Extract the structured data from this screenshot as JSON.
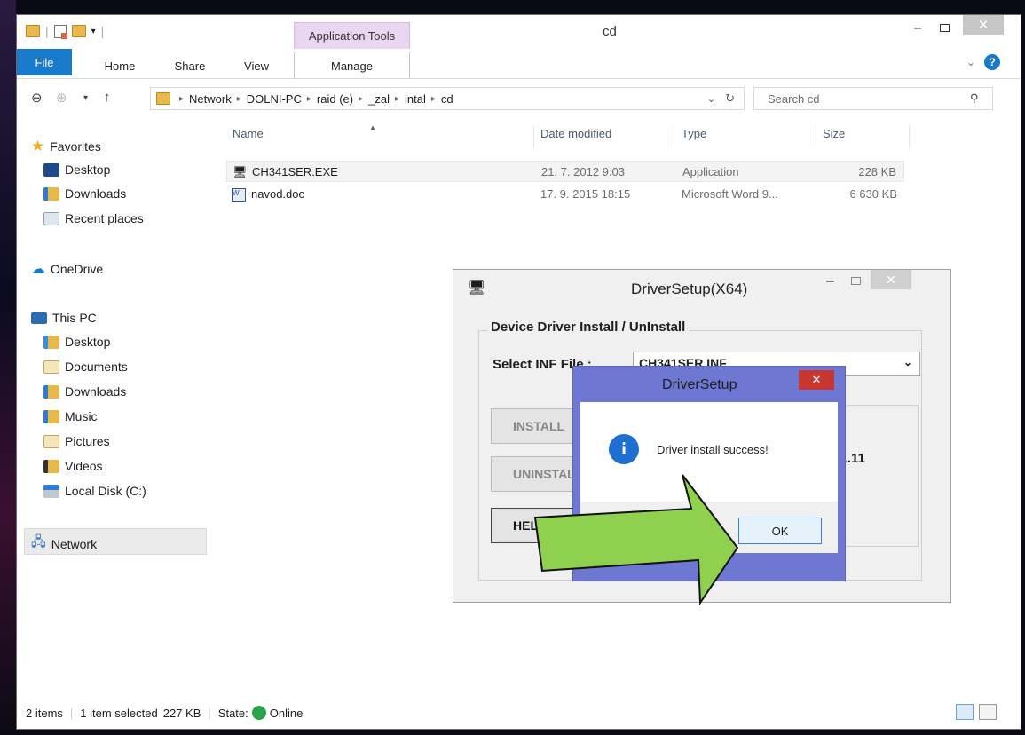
{
  "window": {
    "title": "cd",
    "app_tools_label": "Application Tools"
  },
  "ribbon": {
    "tabs": [
      "File",
      "Home",
      "Share",
      "View",
      "Manage"
    ]
  },
  "address": {
    "path": [
      "Network",
      "DOLNI-PC",
      "raid (e)",
      "_zal",
      "intal",
      "cd"
    ],
    "search_placeholder": "Search cd"
  },
  "nav": {
    "favorites": "Favorites",
    "favorites_items": [
      "Desktop",
      "Downloads",
      "Recent places"
    ],
    "onedrive": "OneDrive",
    "thispc": "This PC",
    "thispc_items": [
      "Desktop",
      "Documents",
      "Downloads",
      "Music",
      "Pictures",
      "Videos",
      "Local Disk (C:)"
    ],
    "network": "Network"
  },
  "columns": {
    "name": "Name",
    "date": "Date modified",
    "type": "Type",
    "size": "Size"
  },
  "files": [
    {
      "name": "CH341SER.EXE",
      "date": "21. 7. 2012 9:03",
      "type": "Application",
      "size": "228 KB"
    },
    {
      "name": "navod.doc",
      "date": "17. 9. 2015 18:15",
      "type": "Microsoft Word 9...",
      "size": "6 630 KB"
    }
  ],
  "status": {
    "items": "2 items",
    "selected": "1 item selected",
    "size": "227 KB",
    "state_label": "State:",
    "state_value": "Online"
  },
  "driver_setup": {
    "title": "DriverSetup(X64)",
    "group_label": "Device Driver Install / UnInstall",
    "select_label": "Select INF File :",
    "select_value": "CH341SER.INF",
    "install_btn": "INSTALL",
    "uninstall_btn": "UNINSTALL",
    "help_btn": "HELP",
    "date_fragment": "11.11"
  },
  "message": {
    "title": "DriverSetup",
    "text": "Driver install success!",
    "ok": "OK"
  },
  "colors": {
    "accent": "#1979ca",
    "dialog_frame": "#6e78d3",
    "close_red": "#c7372f",
    "arrow_green": "#8fd14f"
  }
}
